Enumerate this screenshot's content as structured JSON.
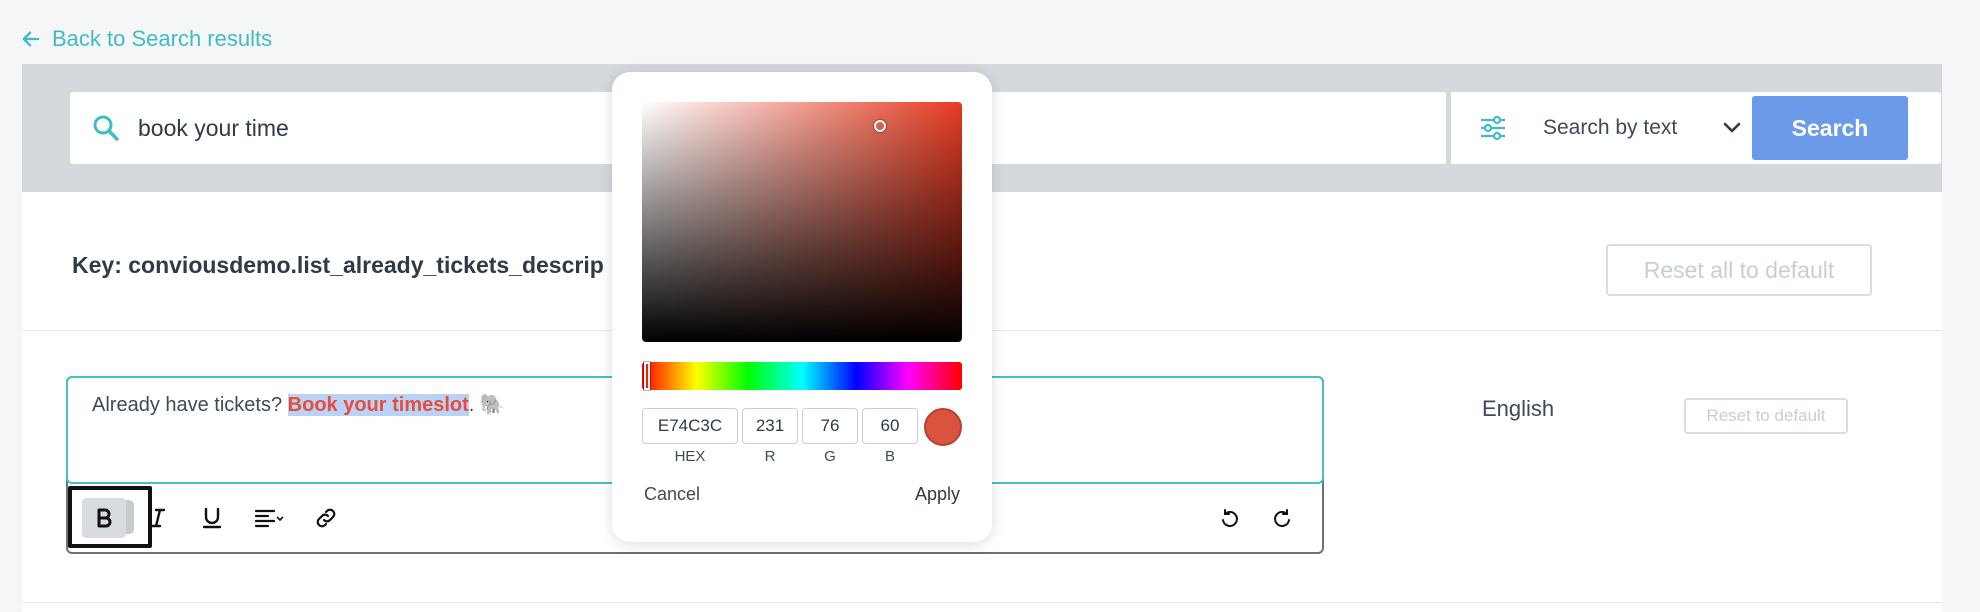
{
  "nav": {
    "back_label": "Back to Search results"
  },
  "search": {
    "query": "book your time",
    "mode_label": "Search by text",
    "button_label": "Search"
  },
  "key_section": {
    "title": "Key: conviousdemo.list_already_tickets_descrip",
    "reset_all_label": "Reset all to default"
  },
  "editor": {
    "text_before": "Already have tickets? ",
    "highlighted_text": "Book your timeslot",
    "text_after": ". ",
    "emoji": "🐘",
    "highlight_color": "#e74c3c"
  },
  "language_row": {
    "language": "English",
    "reset_label": "Reset to default"
  },
  "color_picker": {
    "hex": "E74C3C",
    "r": "231",
    "g": "76",
    "b": "60",
    "hex_label": "HEX",
    "r_label": "R",
    "g_label": "G",
    "b_label": "B",
    "cancel_label": "Cancel",
    "apply_label": "Apply"
  },
  "colors": {
    "accent_teal": "#3fbcc4",
    "search_button": "#6b9ae8",
    "selected_color": "#e74c3c"
  }
}
